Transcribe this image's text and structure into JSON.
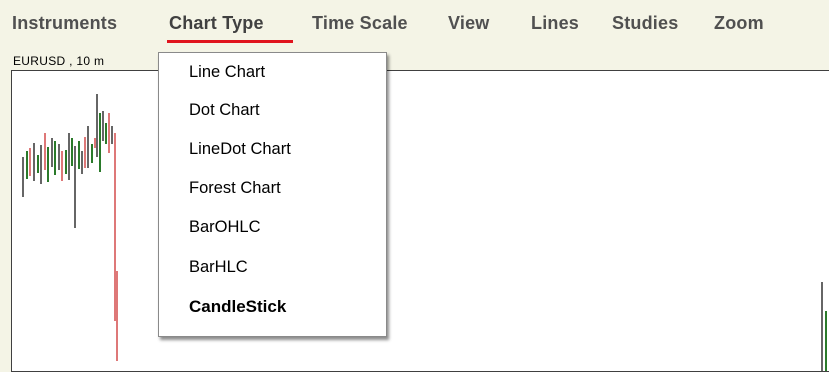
{
  "menubar": {
    "items": [
      {
        "label": "Instruments"
      },
      {
        "label": "Chart Type",
        "active": true
      },
      {
        "label": "Time Scale"
      },
      {
        "label": "View"
      },
      {
        "label": "Lines"
      },
      {
        "label": "Studies"
      },
      {
        "label": "Zoom"
      }
    ]
  },
  "chart": {
    "symbol_label": "EURUSD , 10 m"
  },
  "dropdown": {
    "items": [
      {
        "label": "Line Chart"
      },
      {
        "label": "Dot Chart"
      },
      {
        "label": "LineDot Chart"
      },
      {
        "label": "Forest Chart"
      },
      {
        "label": "BarOHLC"
      },
      {
        "label": "BarHLC"
      },
      {
        "label": "CandleStick",
        "selected": true
      }
    ]
  },
  "colors": {
    "background": "#f4f4e6",
    "menu_text": "#505050",
    "active_underline": "#e0141e",
    "bull_bar": "#2a7a2a",
    "bear_bar": "#c81e1e",
    "neutral_bar": "#000000"
  }
}
